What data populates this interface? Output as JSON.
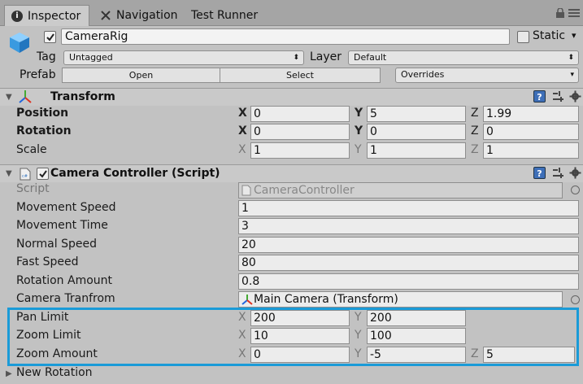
{
  "tabs": [
    {
      "label": "Inspector",
      "icon": "info-icon"
    },
    {
      "label": "Navigation",
      "icon": "navigation-icon"
    },
    {
      "label": "Test Runner",
      "icon": ""
    }
  ],
  "header": {
    "object_name": "CameraRig",
    "active": true,
    "static_label": "Static",
    "static_checked": false,
    "tag_label": "Tag",
    "tag_value": "Untagged",
    "layer_label": "Layer",
    "layer_value": "Default",
    "prefab_label": "Prefab",
    "open_label": "Open",
    "select_label": "Select",
    "overrides_label": "Overrides"
  },
  "transform": {
    "title": "Transform",
    "rows": [
      {
        "label": "Position",
        "bold": true,
        "x": "0",
        "y": "5",
        "z": "1.99"
      },
      {
        "label": "Rotation",
        "bold": true,
        "x": "0",
        "y": "0",
        "z": "0"
      },
      {
        "label": "Scale",
        "bold": false,
        "x": "1",
        "y": "1",
        "z": "1"
      }
    ]
  },
  "camera_controller": {
    "title": "Camera Controller (Script)",
    "script_label": "Script",
    "script_value": "CameraController",
    "fields": [
      {
        "label": "Movement Speed",
        "value": "1"
      },
      {
        "label": "Movement Time",
        "value": "3"
      },
      {
        "label": "Normal Speed",
        "value": "20"
      },
      {
        "label": "Fast Speed",
        "value": "80"
      },
      {
        "label": "Rotation Amount",
        "value": "0.8"
      },
      {
        "label": "Camera Tranfrom",
        "value": "Main Camera (Transform)"
      }
    ],
    "pan_limit": {
      "label": "Pan Limit",
      "x": "200",
      "y": "200"
    },
    "zoom_limit": {
      "label": "Zoom Limit",
      "x": "10",
      "y": "100"
    },
    "zoom_amount": {
      "label": "Zoom Amount",
      "x": "0",
      "y": "-5",
      "z": "5"
    },
    "new_rotation_label": "New Rotation"
  },
  "axis_labels": {
    "x": "X",
    "y": "Y",
    "z": "Z"
  },
  "colors": {
    "highlight": "#1a9bd8",
    "help": "#3e6fb8"
  }
}
